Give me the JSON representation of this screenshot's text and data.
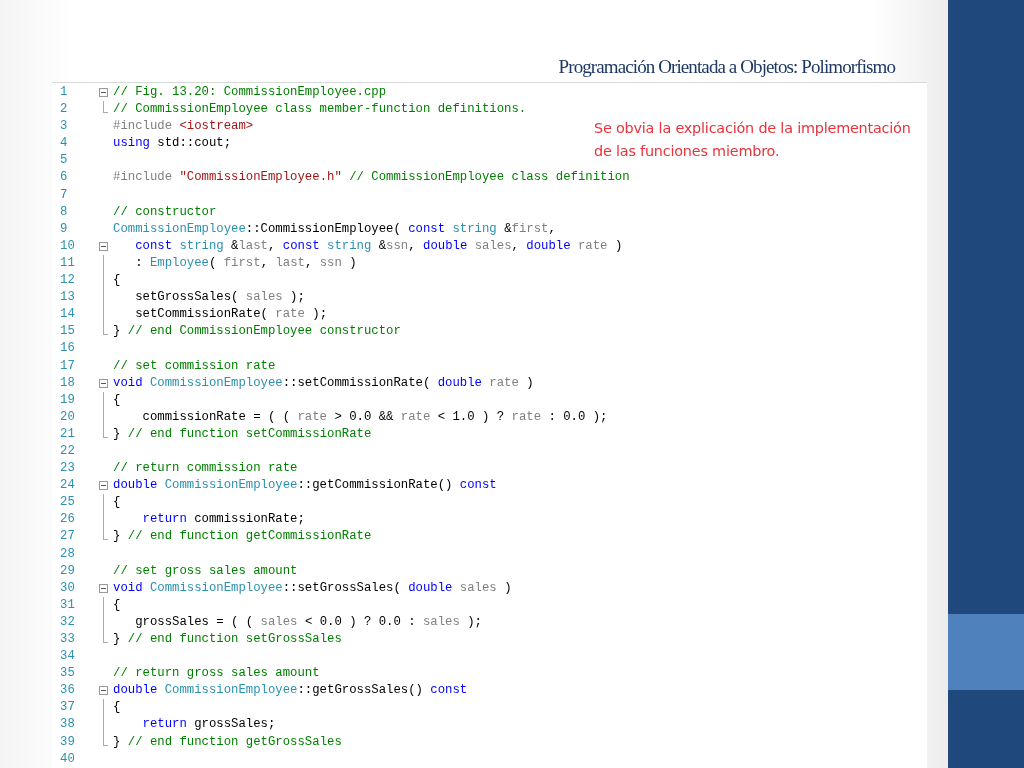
{
  "slide_title": "Programación Orientada a Objetos: Polimorfismo",
  "note": [
    "Se obvia la explicación de la implementación",
    "de las funciones miembro."
  ],
  "code_lines": [
    {
      "number": "1",
      "kind": "fold_start",
      "tokens": [
        {
          "kind": "comment",
          "text": "// Fig. 13.20: CommissionEmployee.cpp"
        }
      ]
    },
    {
      "number": "2",
      "kind": "fold_end",
      "tokens": [
        {
          "kind": "comment",
          "text": "// CommissionEmployee class member-function definitions."
        }
      ]
    },
    {
      "number": "3",
      "kind": "plain",
      "tokens": [
        {
          "kind": "preproc",
          "text": "#include "
        },
        {
          "kind": "string",
          "text": "<iostream>"
        }
      ]
    },
    {
      "number": "4",
      "kind": "plain",
      "tokens": [
        {
          "kind": "keyword",
          "text": "using"
        },
        {
          "kind": "plain",
          "text": " std::cout;"
        }
      ]
    },
    {
      "number": "5",
      "kind": "plain"
    },
    {
      "number": "6",
      "kind": "plain",
      "tokens": [
        {
          "kind": "preproc",
          "text": "#include "
        },
        {
          "kind": "string",
          "text": "\"CommissionEmployee.h\""
        },
        {
          "kind": "comment",
          "text": " // CommissionEmployee class definition"
        }
      ]
    },
    {
      "number": "7",
      "kind": "plain"
    },
    {
      "number": "8",
      "kind": "plain",
      "tokens": [
        {
          "kind": "comment",
          "text": "// constructor"
        }
      ]
    },
    {
      "number": "9",
      "kind": "plain",
      "tokens": [
        {
          "kind": "type",
          "text": "CommissionEmployee"
        },
        {
          "kind": "plain",
          "text": "::CommissionEmployee( "
        },
        {
          "kind": "keyword",
          "text": "const "
        },
        {
          "kind": "type",
          "text": "string"
        },
        {
          "kind": "plain",
          "text": " &"
        },
        {
          "kind": "param",
          "text": "first"
        },
        {
          "kind": "plain",
          "text": ","
        }
      ]
    },
    {
      "number": "10",
      "kind": "fold_start",
      "tokens": [
        {
          "kind": "keyword",
          "text": "   const "
        },
        {
          "kind": "type",
          "text": "string"
        },
        {
          "kind": "plain",
          "text": " &"
        },
        {
          "kind": "param",
          "text": "last"
        },
        {
          "kind": "plain",
          "text": ", "
        },
        {
          "kind": "keyword",
          "text": "const "
        },
        {
          "kind": "type",
          "text": "string"
        },
        {
          "kind": "plain",
          "text": " &"
        },
        {
          "kind": "param",
          "text": "ssn"
        },
        {
          "kind": "plain",
          "text": ", "
        },
        {
          "kind": "keyword",
          "text": "double "
        },
        {
          "kind": "param",
          "text": "sales"
        },
        {
          "kind": "plain",
          "text": ", "
        },
        {
          "kind": "keyword",
          "text": "double "
        },
        {
          "kind": "param",
          "text": "rate"
        },
        {
          "kind": "plain",
          "text": " )"
        }
      ]
    },
    {
      "number": "11",
      "kind": "fold_body",
      "tokens": [
        {
          "kind": "plain",
          "text": "   : "
        },
        {
          "kind": "type",
          "text": "Employee"
        },
        {
          "kind": "plain",
          "text": "( "
        },
        {
          "kind": "param",
          "text": "first"
        },
        {
          "kind": "plain",
          "text": ", "
        },
        {
          "kind": "param",
          "text": "last"
        },
        {
          "kind": "plain",
          "text": ", "
        },
        {
          "kind": "param",
          "text": "ssn"
        },
        {
          "kind": "plain",
          "text": " )"
        }
      ]
    },
    {
      "number": "12",
      "kind": "fold_body",
      "tokens": [
        {
          "kind": "plain",
          "text": "{"
        }
      ]
    },
    {
      "number": "13",
      "kind": "fold_body",
      "tokens": [
        {
          "kind": "plain",
          "text": "   setGrossSales( "
        },
        {
          "kind": "param",
          "text": "sales"
        },
        {
          "kind": "plain",
          "text": " );"
        }
      ]
    },
    {
      "number": "14",
      "kind": "fold_body",
      "tokens": [
        {
          "kind": "plain",
          "text": "   setCommissionRate( "
        },
        {
          "kind": "param",
          "text": "rate"
        },
        {
          "kind": "plain",
          "text": " );"
        }
      ]
    },
    {
      "number": "15",
      "kind": "fold_end",
      "tokens": [
        {
          "kind": "plain",
          "text": "} "
        },
        {
          "kind": "comment",
          "text": "// end CommissionEmployee constructor"
        }
      ]
    },
    {
      "number": "16",
      "kind": "plain"
    },
    {
      "number": "17",
      "kind": "plain",
      "tokens": [
        {
          "kind": "comment",
          "text": "// set commission rate"
        }
      ]
    },
    {
      "number": "18",
      "kind": "fold_start",
      "tokens": [
        {
          "kind": "keyword",
          "text": "void "
        },
        {
          "kind": "type",
          "text": "CommissionEmployee"
        },
        {
          "kind": "plain",
          "text": "::setCommissionRate( "
        },
        {
          "kind": "keyword",
          "text": "double "
        },
        {
          "kind": "param",
          "text": "rate"
        },
        {
          "kind": "plain",
          "text": " )"
        }
      ]
    },
    {
      "number": "19",
      "kind": "fold_body",
      "tokens": [
        {
          "kind": "plain",
          "text": "{"
        }
      ]
    },
    {
      "number": "20",
      "kind": "fold_body",
      "tokens": [
        {
          "kind": "plain",
          "text": "    commissionRate = ( ( "
        },
        {
          "kind": "param",
          "text": "rate"
        },
        {
          "kind": "plain",
          "text": " > 0.0 && "
        },
        {
          "kind": "param",
          "text": "rate"
        },
        {
          "kind": "plain",
          "text": " < 1.0 ) ? "
        },
        {
          "kind": "param",
          "text": "rate"
        },
        {
          "kind": "plain",
          "text": " : 0.0 );"
        }
      ]
    },
    {
      "number": "21",
      "kind": "fold_end",
      "tokens": [
        {
          "kind": "plain",
          "text": "} "
        },
        {
          "kind": "comment",
          "text": "// end function setCommissionRate"
        }
      ]
    },
    {
      "number": "22",
      "kind": "plain"
    },
    {
      "number": "23",
      "kind": "plain",
      "tokens": [
        {
          "kind": "comment",
          "text": "// return commission rate"
        }
      ]
    },
    {
      "number": "24",
      "kind": "fold_start",
      "tokens": [
        {
          "kind": "keyword",
          "text": "double "
        },
        {
          "kind": "type",
          "text": "CommissionEmployee"
        },
        {
          "kind": "plain",
          "text": "::getCommissionRate() "
        },
        {
          "kind": "keyword",
          "text": "const"
        }
      ]
    },
    {
      "number": "25",
      "kind": "fold_body",
      "tokens": [
        {
          "kind": "plain",
          "text": "{"
        }
      ]
    },
    {
      "number": "26",
      "kind": "fold_body",
      "tokens": [
        {
          "kind": "keyword",
          "text": "    return"
        },
        {
          "kind": "plain",
          "text": " commissionRate;"
        }
      ]
    },
    {
      "number": "27",
      "kind": "fold_end",
      "tokens": [
        {
          "kind": "plain",
          "text": "} "
        },
        {
          "kind": "comment",
          "text": "// end function getCommissionRate"
        }
      ]
    },
    {
      "number": "28",
      "kind": "plain"
    },
    {
      "number": "29",
      "kind": "plain",
      "tokens": [
        {
          "kind": "comment",
          "text": "// set gross sales amount"
        }
      ]
    },
    {
      "number": "30",
      "kind": "fold_start",
      "tokens": [
        {
          "kind": "keyword",
          "text": "void "
        },
        {
          "kind": "type",
          "text": "CommissionEmployee"
        },
        {
          "kind": "plain",
          "text": "::setGrossSales( "
        },
        {
          "kind": "keyword",
          "text": "double "
        },
        {
          "kind": "param",
          "text": "sales"
        },
        {
          "kind": "plain",
          "text": " )"
        }
      ]
    },
    {
      "number": "31",
      "kind": "fold_body",
      "tokens": [
        {
          "kind": "plain",
          "text": "{"
        }
      ]
    },
    {
      "number": "32",
      "kind": "fold_body",
      "tokens": [
        {
          "kind": "plain",
          "text": "   grossSales = ( ( "
        },
        {
          "kind": "param",
          "text": "sales"
        },
        {
          "kind": "plain",
          "text": " < 0.0 ) ? 0.0 : "
        },
        {
          "kind": "param",
          "text": "sales"
        },
        {
          "kind": "plain",
          "text": " );"
        }
      ]
    },
    {
      "number": "33",
      "kind": "fold_end",
      "tokens": [
        {
          "kind": "plain",
          "text": "} "
        },
        {
          "kind": "comment",
          "text": "// end function setGrossSales"
        }
      ]
    },
    {
      "number": "34",
      "kind": "plain"
    },
    {
      "number": "35",
      "kind": "plain",
      "tokens": [
        {
          "kind": "comment",
          "text": "// return gross sales amount"
        }
      ]
    },
    {
      "number": "36",
      "kind": "fold_start",
      "tokens": [
        {
          "kind": "keyword",
          "text": "double "
        },
        {
          "kind": "type",
          "text": "CommissionEmployee"
        },
        {
          "kind": "plain",
          "text": "::getGrossSales() "
        },
        {
          "kind": "keyword",
          "text": "const"
        }
      ]
    },
    {
      "number": "37",
      "kind": "fold_body",
      "tokens": [
        {
          "kind": "plain",
          "text": "{"
        }
      ]
    },
    {
      "number": "38",
      "kind": "fold_body",
      "tokens": [
        {
          "kind": "keyword",
          "text": "    return"
        },
        {
          "kind": "plain",
          "text": " grossSales;"
        }
      ]
    },
    {
      "number": "39",
      "kind": "fold_end",
      "tokens": [
        {
          "kind": "plain",
          "text": "} "
        },
        {
          "kind": "comment",
          "text": "// end function getGrossSales"
        }
      ]
    },
    {
      "number": "40",
      "kind": "plain"
    }
  ]
}
